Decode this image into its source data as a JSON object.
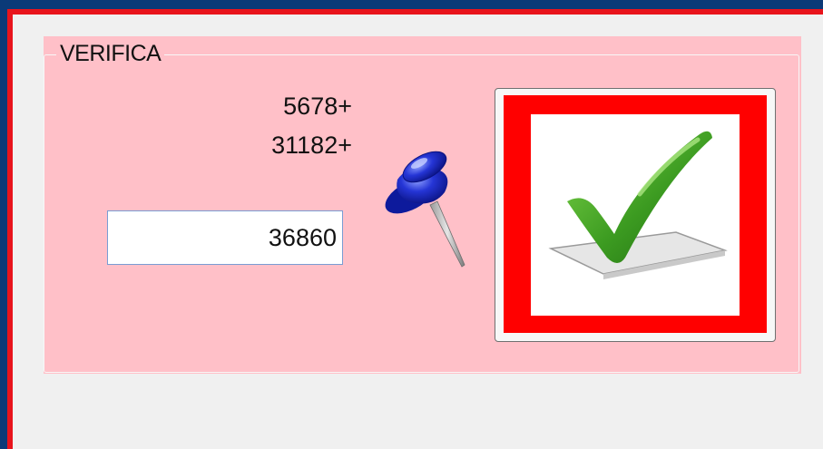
{
  "groupbox": {
    "legend": "VERIFICA"
  },
  "problem": {
    "addend_1": "5678+",
    "addend_2": "31182+"
  },
  "answer": {
    "value": "36860"
  },
  "icons": {
    "pin": "pushpin-icon",
    "check": "checkmark-icon"
  },
  "colors": {
    "window_frame": "#0b3a78",
    "window_border": "#e8141c",
    "groupbox_background": "#ffc0c8",
    "button_frame": "#ff0000",
    "checkmark": "#3c9b21",
    "pin": "#1a2fc8"
  }
}
